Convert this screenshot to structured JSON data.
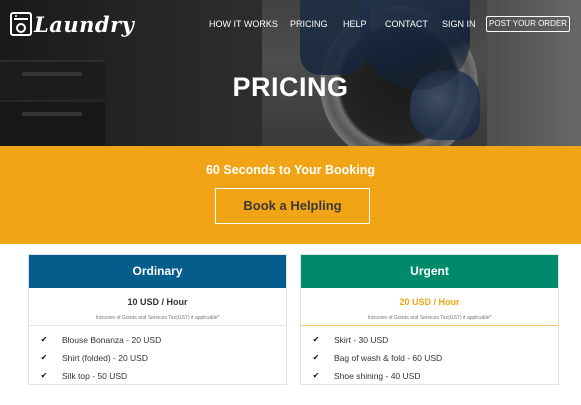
{
  "brand": {
    "logo_text": "Laundry",
    "icon": "washing-machine-icon"
  },
  "nav": {
    "items": [
      {
        "label": "HOW IT WORKS"
      },
      {
        "label": "PRICING"
      },
      {
        "label": "HELP"
      },
      {
        "label": "CONTACT"
      },
      {
        "label": "SIGN IN"
      }
    ],
    "cta_label": "POST YOUR ORDER"
  },
  "hero": {
    "title": "PRICING"
  },
  "booking": {
    "title": "60 Seconds to Your Booking",
    "button_label": "Book a Helpling",
    "background_color": "#f1a516"
  },
  "plans": [
    {
      "name": "Ordinary",
      "price": "10 USD / Hour",
      "note": "Inclusive of Goods and Services Tax(GST) if applicable*",
      "header_color": "#045d8a",
      "items": [
        {
          "icon": "check-icon",
          "label": "Blouse Bonanza - 20 USD"
        },
        {
          "icon": "check-icon",
          "label": "Shirt (folded) - 20 USD"
        },
        {
          "icon": "check-icon",
          "label": "Silk top - 50 USD"
        }
      ]
    },
    {
      "name": "Urgent",
      "price": "20 USD / Hour",
      "note": "Inclusive of Goods and Services Tax(GST) if applicable*",
      "header_color": "#008a6c",
      "price_color": "#f1a516",
      "items": [
        {
          "icon": "check-icon",
          "label": "Skirt - 30 USD"
        },
        {
          "icon": "check-icon",
          "label": "Bag of wash & fold - 60 USD"
        },
        {
          "icon": "check-icon",
          "label": "Shoe shining - 40 USD"
        }
      ]
    }
  ]
}
